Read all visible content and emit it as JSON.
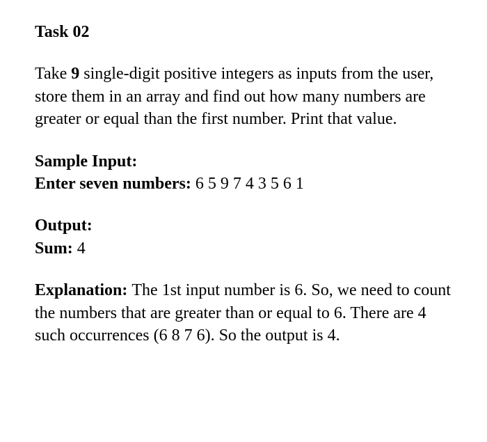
{
  "task": {
    "title": "Task 02",
    "description_parts": {
      "pre": "Take ",
      "bold_num": "9",
      "post": " single-digit positive integers as inputs from the user, store them in an array and find out how many numbers are greater or equal than the first number. Print that value."
    }
  },
  "sample_input": {
    "heading": "Sample Input:",
    "prompt": "Enter seven numbers: ",
    "values": "6 5 9 7 4 3 5 6 1"
  },
  "output": {
    "heading": "Output:",
    "label": "Sum: ",
    "value": "4"
  },
  "explanation": {
    "heading": "Explanation: ",
    "text": "The 1st input number is 6. So, we need to count the numbers that are greater than or equal to 6. There are 4 such occurrences (6 8 7 6). So the output is 4."
  }
}
